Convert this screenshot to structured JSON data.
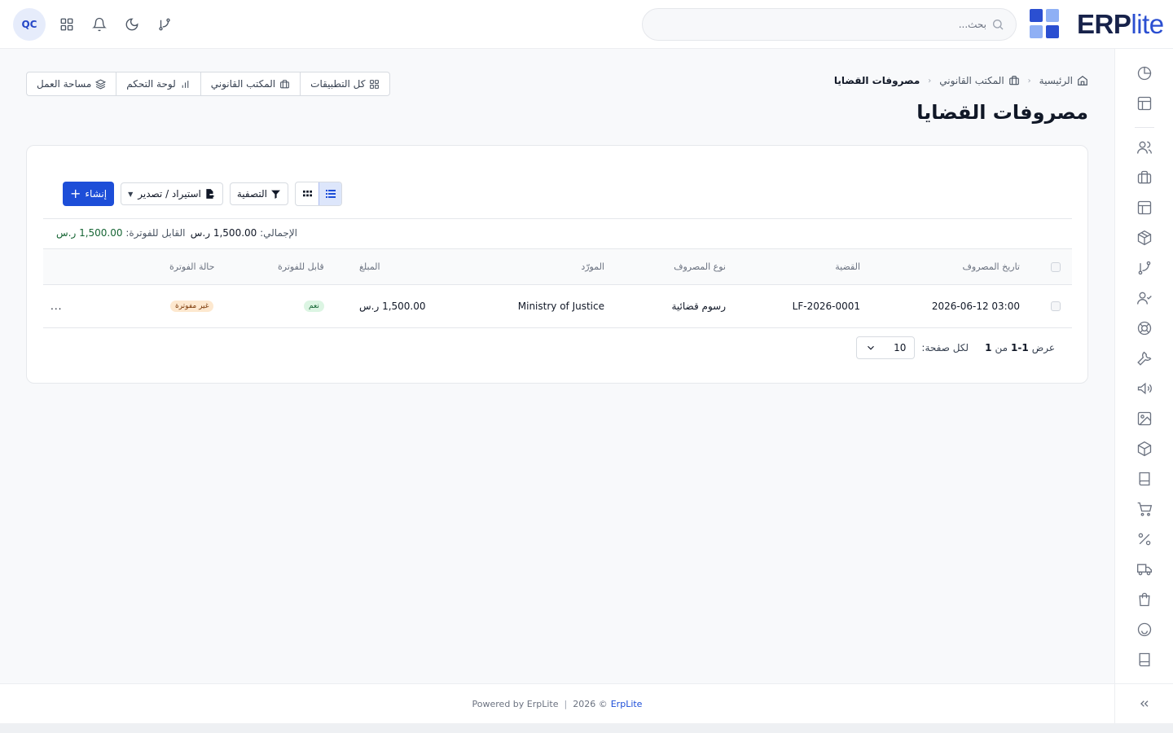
{
  "header": {
    "avatar": "QC",
    "search_placeholder": "بحث...",
    "brand_bold": "ERP",
    "brand_light": "lite",
    "logo_colors": [
      "#2b4fd1",
      "#8fb0f5",
      "#8fb0f5",
      "#2b4fd1"
    ],
    "icons": [
      "apps-grid-icon",
      "bell-icon",
      "moon-icon",
      "git-branch-icon"
    ]
  },
  "breadcrumb": {
    "home": "الرئيسية",
    "section": "المكتب القانوني",
    "current": "مصروفات القضايا"
  },
  "page_title": "مصروفات القضايا",
  "quicknav": {
    "all_apps": "كل التطبيقات",
    "legal_office": "المكتب القانوني",
    "dashboard": "لوحة التحكم",
    "workspace": "مساحة العمل"
  },
  "toolbar": {
    "create": "إنشاء",
    "import_export": "استيراد / تصدير",
    "filter": "التصفية"
  },
  "summary": {
    "total_label": "الإجمالي:",
    "total_value": "1,500.00 ر.س",
    "billable_label": "القابل للفوترة:",
    "billable_value": "1,500.00 ر.س"
  },
  "table": {
    "columns": {
      "date": "تاريخ المصروف",
      "case": "القضية",
      "type": "نوع المصروف",
      "vendor": "المورّد",
      "amount": "المبلغ",
      "billable": "قابل للفوترة",
      "invoice_status": "حالة الفوترة"
    },
    "rows": [
      {
        "date": "2026-06-12 03:00",
        "case": "LF-2026-0001",
        "type": "رسوم قضائية",
        "vendor": "Ministry of Justice",
        "amount": "1,500.00 ر.س",
        "billable": "نعم",
        "invoice_status": "غير مفوترة",
        "actions": "..."
      }
    ]
  },
  "pagination": {
    "showing_label": "عرض",
    "range": "1-1",
    "of_label": "من",
    "total": "1",
    "per_page_label": "لكل صفحة:",
    "per_page_value": "10"
  },
  "footer": {
    "powered": "Powered by ErpLite",
    "copyright": "2026 ©",
    "brand_link": "ErpLite"
  },
  "sidebar_icons": [
    "chart-pie-icon",
    "layout-icon",
    "users-icon",
    "briefcase-icon",
    "layout-icon",
    "package-icon",
    "git-branch-icon",
    "user-check-icon",
    "lifebuoy-icon",
    "wrench-icon",
    "megaphone-icon",
    "image-icon",
    "box-icon",
    "book-icon",
    "cart-icon",
    "percent-icon",
    "truck-icon",
    "shopping-bag-icon",
    "smile-icon",
    "book-icon",
    "chevrons-left-icon"
  ]
}
